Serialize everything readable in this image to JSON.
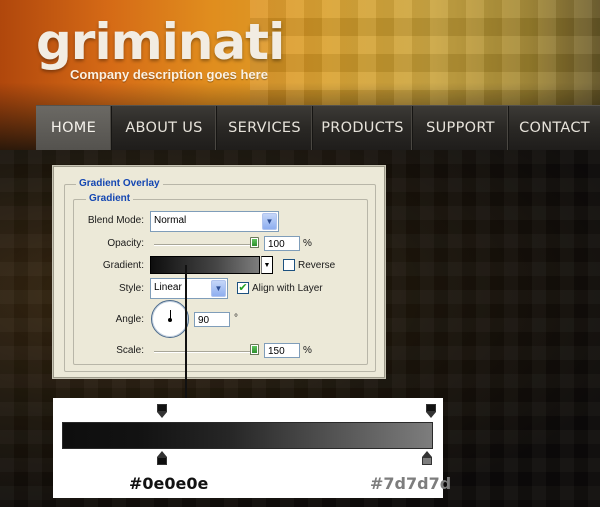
{
  "brand": {
    "logo": "griminati",
    "tagline": "Company description goes here"
  },
  "nav": {
    "items": [
      {
        "label": "HOME",
        "active": true
      },
      {
        "label": "ABOUT US",
        "active": false
      },
      {
        "label": "SERVICES",
        "active": false
      },
      {
        "label": "PRODUCTS",
        "active": false
      },
      {
        "label": "SUPPORT",
        "active": false
      },
      {
        "label": "CONTACT",
        "active": false
      }
    ]
  },
  "dialog": {
    "group_title": "Gradient Overlay",
    "subgroup_title": "Gradient",
    "blend_mode": {
      "label": "Blend Mode:",
      "value": "Normal"
    },
    "opacity": {
      "label": "Opacity:",
      "value": "100",
      "unit": "%",
      "level": 1.0
    },
    "gradient": {
      "label": "Gradient:",
      "reverse_label": "Reverse",
      "reverse_checked": false
    },
    "style": {
      "label": "Style:",
      "value": "Linear",
      "align_label": "Align with Layer",
      "align_checked": true
    },
    "angle": {
      "label": "Angle:",
      "value": "90",
      "unit": "°"
    },
    "scale": {
      "label": "Scale:",
      "value": "150",
      "unit": "%"
    }
  },
  "gradient_editor": {
    "start_color": "#0e0e0e",
    "end_color": "#7d7d7d",
    "start_label": "#0e0e0e",
    "end_label": "#7d7d7d"
  },
  "icons": {
    "dropdown": "chevron-down-icon",
    "check": "checkmark-icon"
  }
}
